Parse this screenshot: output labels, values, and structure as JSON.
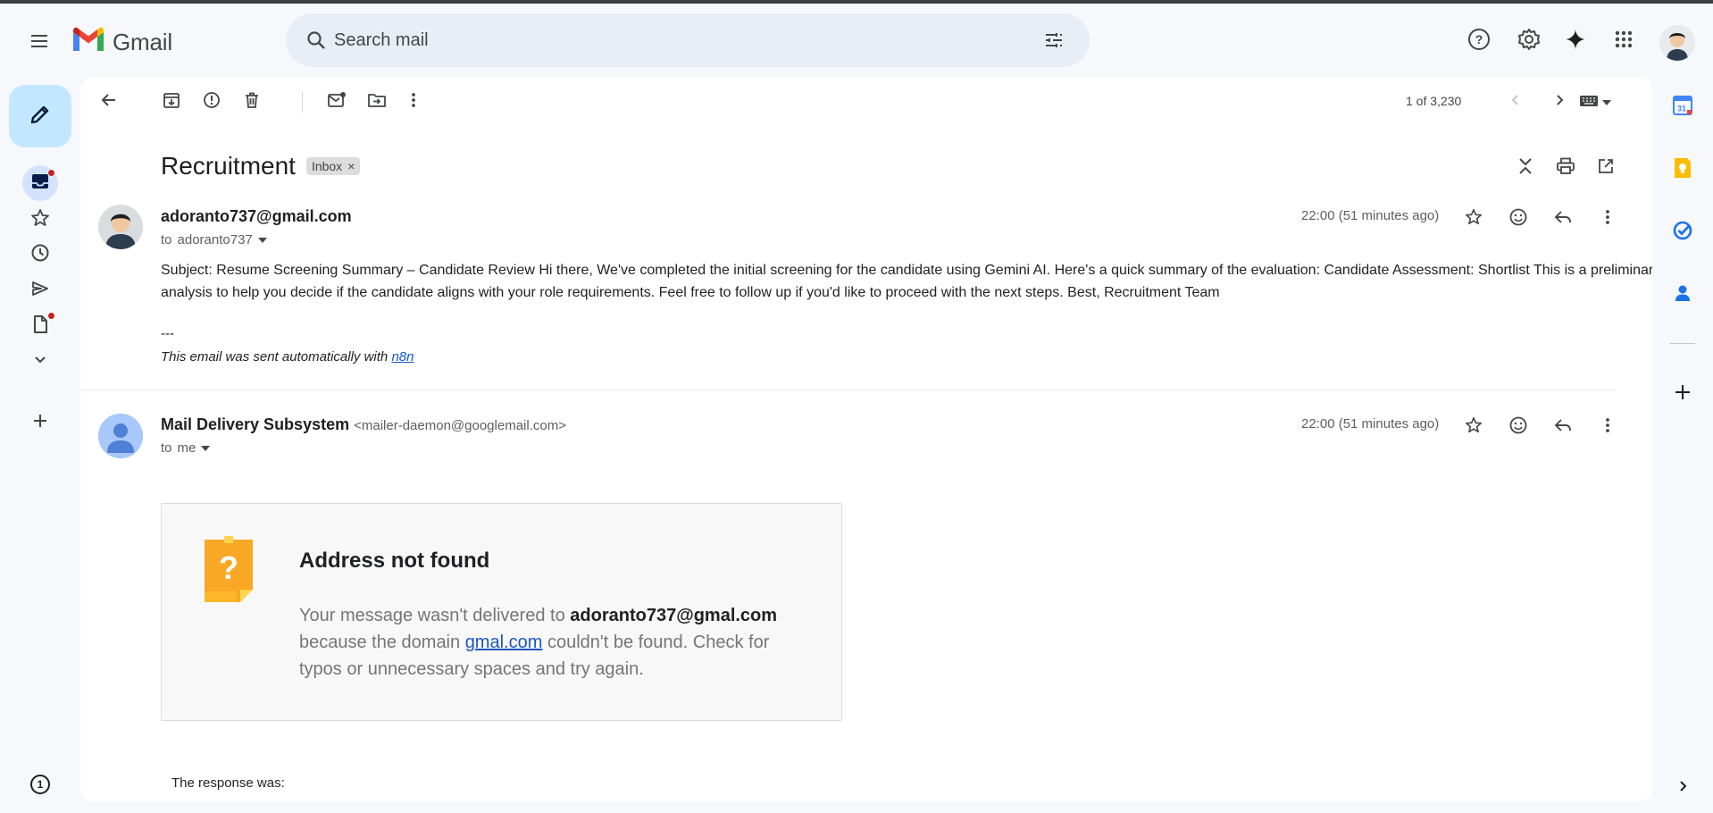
{
  "app": {
    "name": "Gmail"
  },
  "search": {
    "placeholder": "Search mail"
  },
  "toolbar": {
    "pagination": "1 of 3,230"
  },
  "thread": {
    "subject": "Recruitment",
    "label": "Inbox",
    "label_remove": "×"
  },
  "messages": [
    {
      "sender": "adoranto737@gmail.com",
      "recipient_prefix": "to",
      "recipient": "adoranto737",
      "time": "22:00 (51 minutes ago)",
      "body": "Subject: Resume Screening Summary – Candidate Review Hi there, We've completed the initial screening for the candidate using Gemini AI. Here's a quick summary of the evaluation: Candidate Assessment: Shortlist This is a preliminary analysis to help you decide if the candidate aligns with your role requirements. Feel free to follow up if you'd like to proceed with the next steps. Best, Recruitment Team",
      "sig_dashes": "---",
      "sig_text": "This email was sent automatically with ",
      "sig_link": "n8n"
    },
    {
      "sender": "Mail Delivery Subsystem",
      "sender_email": "<mailer-daemon@googlemail.com>",
      "recipient_prefix": "to",
      "recipient": "me",
      "time": "22:00 (51 minutes ago)",
      "bounce": {
        "title": "Address not found",
        "text_1": "Your message wasn't delivered to ",
        "address": "adoranto737@gmal.com",
        "text_2": " because the domain ",
        "domain": "gmal.com",
        "text_3": " couldn't be found. Check for typos or unnecessary spaces and try again.",
        "icon_glyph": "?"
      },
      "response": "The response was:"
    }
  ],
  "side_panel": {
    "calendar_day": "31"
  },
  "bottom_badge": "1",
  "colors": {
    "accent": "#0b57d0",
    "compose_bg": "#c2e7ff",
    "page_bg": "#f6f8fc",
    "unread_dot": "#c5221f",
    "bounce_icon": "#f9a825"
  },
  "icons": {
    "header": [
      "menu-icon",
      "search-icon",
      "filter-icon",
      "help-icon",
      "settings-icon",
      "gemini-icon",
      "apps-icon",
      "account-avatar"
    ],
    "rail": [
      "compose-pencil-icon",
      "inbox-icon",
      "star-icon",
      "clock-icon",
      "send-icon",
      "draft-icon",
      "chevron-down-icon",
      "plus-icon"
    ],
    "toolbar": [
      "back-arrow-icon",
      "archive-icon",
      "report-spam-icon",
      "delete-icon",
      "mark-unread-icon",
      "move-to-icon",
      "more-vert-icon",
      "prev-icon",
      "next-icon",
      "keyboard-icon"
    ],
    "message": [
      "star-icon",
      "emoji-icon",
      "reply-icon",
      "more-vert-icon"
    ],
    "side": [
      "calendar-icon",
      "keep-icon",
      "tasks-icon",
      "contacts-icon",
      "plus-icon",
      "chevron-right-icon"
    ]
  }
}
